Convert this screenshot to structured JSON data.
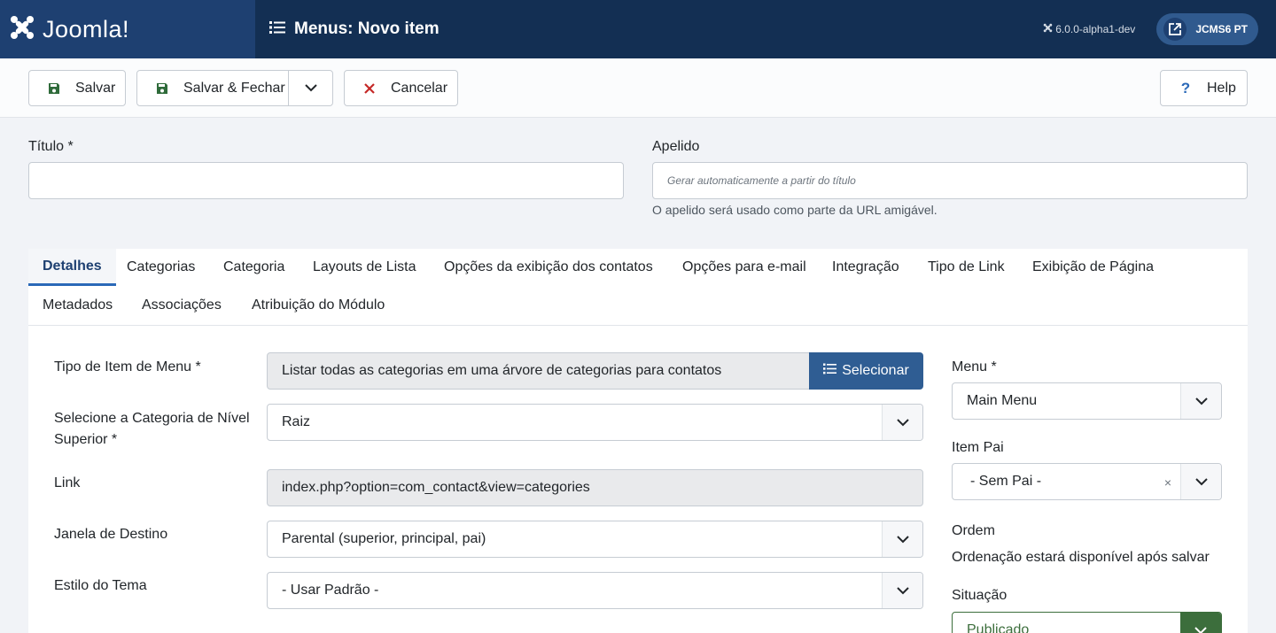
{
  "header": {
    "logo_text": "Joomla!",
    "page_title": "Menus: Novo item",
    "version": "6.0.0-alpha1-dev",
    "site_button_label": "JCMS6 PT"
  },
  "toolbar": {
    "save_label": "Salvar",
    "save_close_label": "Salvar & Fechar",
    "cancel_label": "Cancelar",
    "help_label": "Help"
  },
  "form": {
    "title_label": "Título *",
    "title_value": "",
    "alias_label": "Apelido",
    "alias_placeholder": "Gerar automaticamente a partir do título",
    "alias_help": "O apelido será usado como parte da URL amigável."
  },
  "tabs": [
    {
      "label": "Detalhes",
      "active": true
    },
    {
      "label": "Categorias"
    },
    {
      "label": "Categoria"
    },
    {
      "label": "Layouts de Lista"
    },
    {
      "label": "Opções da exibição dos contatos"
    },
    {
      "label": "Opções para e-mail"
    },
    {
      "label": "Integração"
    },
    {
      "label": "Tipo de Link"
    },
    {
      "label": "Exibição de Página"
    },
    {
      "label": "Metadados"
    },
    {
      "label": "Associações"
    },
    {
      "label": "Atribuição do Módulo"
    }
  ],
  "details": {
    "menu_item_type_label": "Tipo de Item de Menu *",
    "menu_item_type_value": "Listar todas as categorias em uma árvore de categorias para contatos",
    "select_button_label": "Selecionar",
    "parent_category_label_line1": "Selecione a Categoria de Nível",
    "parent_category_label_line2": "Superior *",
    "parent_category_value": "Raiz",
    "link_label": "Link",
    "link_value": "index.php?option=com_contact&view=categories",
    "target_window_label": "Janela de Destino",
    "target_window_value": "Parental (superior, principal, pai)",
    "template_style_label": "Estilo do Tema",
    "template_style_value": "- Usar Padrão -"
  },
  "sidebar": {
    "menu_label": "Menu *",
    "menu_value": "Main Menu",
    "parent_item_label": "Item Pai",
    "parent_item_value": "- Sem Pai -",
    "ordering_label": "Ordem",
    "ordering_text": "Ordenação estará disponível após salvar",
    "status_label": "Situação",
    "status_value": "Publicado"
  },
  "colors": {
    "header_bg": "#132f53",
    "logo_bg": "#1e4071",
    "select_button_bg": "#2f5d93",
    "status_green": "#3c6e3c",
    "save_icon": "#2f6b3a",
    "cancel_icon": "#c52827"
  }
}
